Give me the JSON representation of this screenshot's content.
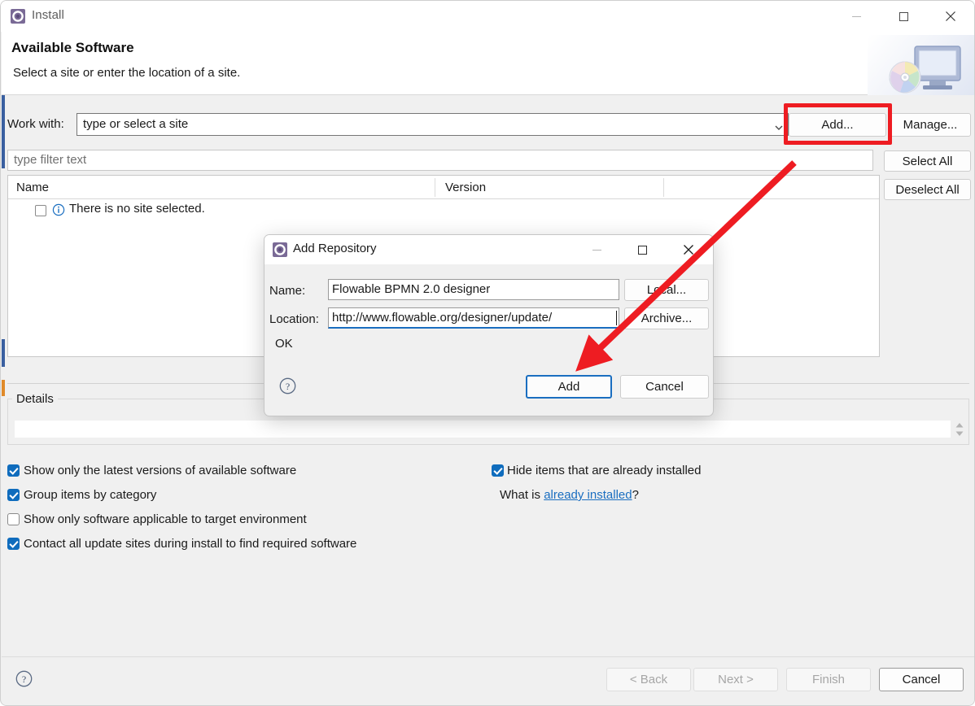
{
  "window": {
    "title": "Install",
    "icon": "gear-icon",
    "minimize": "minimize-icon",
    "maximize": "maximize-icon",
    "close": "close-icon"
  },
  "header": {
    "title": "Available Software",
    "subtitle": "Select a site or enter the location of a site.",
    "banner_icon": "monitor-cd-icon"
  },
  "work_with": {
    "label": "Work with:",
    "value": "type or select a site",
    "placeholder": "type or select a site",
    "dropdown_icon": "chevron-down-icon"
  },
  "buttons": {
    "add": "Add...",
    "manage": "Manage...",
    "select_all": "Select All",
    "deselect_all": "Deselect All"
  },
  "filter": {
    "placeholder": "type filter text",
    "value": ""
  },
  "table": {
    "columns": [
      "Name",
      "Version"
    ],
    "rows": [
      {
        "name": "There is no site selected.",
        "version": "",
        "checked": false,
        "icon": "info-icon"
      }
    ]
  },
  "details": {
    "legend": "Details",
    "value": "",
    "spinner_icon": "spinner-up-down-icon"
  },
  "options": {
    "left": [
      {
        "label": "Show only the latest versions of available software",
        "checked": true
      },
      {
        "label": "Group items by category",
        "checked": true
      },
      {
        "label": "Show only software applicable to target environment",
        "checked": false
      },
      {
        "label": "Contact all update sites during install to find required software",
        "checked": true
      }
    ],
    "right": [
      {
        "label": "Hide items that are already installed",
        "checked": true
      }
    ],
    "what_is_prefix": "What is ",
    "what_is_link": "already installed",
    "what_is_suffix": "?"
  },
  "wizard_buttons": {
    "help_icon": "help-icon",
    "back": "< Back",
    "next": "Next >",
    "finish": "Finish",
    "cancel": "Cancel"
  },
  "dialog": {
    "title": "Add Repository",
    "icon": "gear-icon",
    "minimize": "minimize-icon",
    "maximize": "maximize-icon",
    "close": "close-icon",
    "name_label": "Name:",
    "name_value": "Flowable BPMN 2.0 designer",
    "location_label": "Location:",
    "location_value": "http://www.flowable.org/designer/update/",
    "local_button": "Local...",
    "archive_button": "Archive...",
    "status": "OK",
    "help_icon": "help-icon",
    "add_button": "Add",
    "cancel_button": "Cancel"
  },
  "annotations": {
    "highlight_color": "#ee1c22",
    "highlight_target": "Add...",
    "arrow_color": "#ee1c22",
    "arrow_target": "Add"
  }
}
